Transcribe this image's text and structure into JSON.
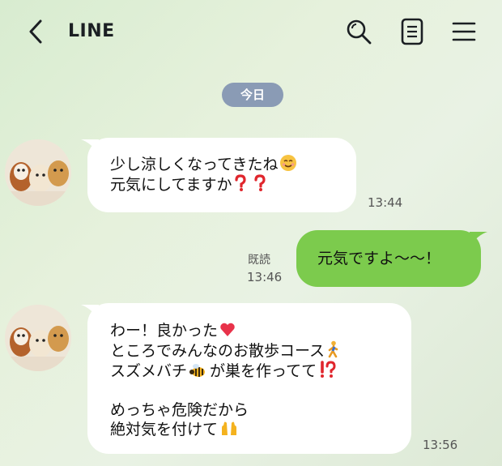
{
  "header": {
    "title": "LINE",
    "icons": [
      "back-arrow-icon",
      "search-icon",
      "notes-icon",
      "menu-icon"
    ]
  },
  "date_separator": "今日",
  "messages": [
    {
      "side": "left",
      "lines": [
        "少し涼しくなってきたね",
        "元気にしてますか"
      ],
      "time": "13:44",
      "emojis": [
        "smiling-face-icon",
        "red-question-mark-icon",
        "red-question-mark-icon"
      ]
    },
    {
      "side": "right",
      "lines": [
        "元気ですよ～～！"
      ],
      "read_label": "既読",
      "time": "13:46"
    },
    {
      "side": "left",
      "lines": [
        "わー！良かった",
        "ところでみんなのお散歩コース",
        "スズメバチ",
        "が巣を作ってて",
        "めっちゃ危険だから",
        "絶対気を付けて"
      ],
      "time": "13:56",
      "emojis": [
        "red-heart-icon",
        "walking-person-icon",
        "hornet-icon",
        "exclamation-question-icon",
        "raised-hands-icon"
      ]
    }
  ],
  "colors": {
    "sent_bubble": "#7ccb4d",
    "received_bubble": "#ffffff",
    "date_pill": "#8a9bb5"
  }
}
